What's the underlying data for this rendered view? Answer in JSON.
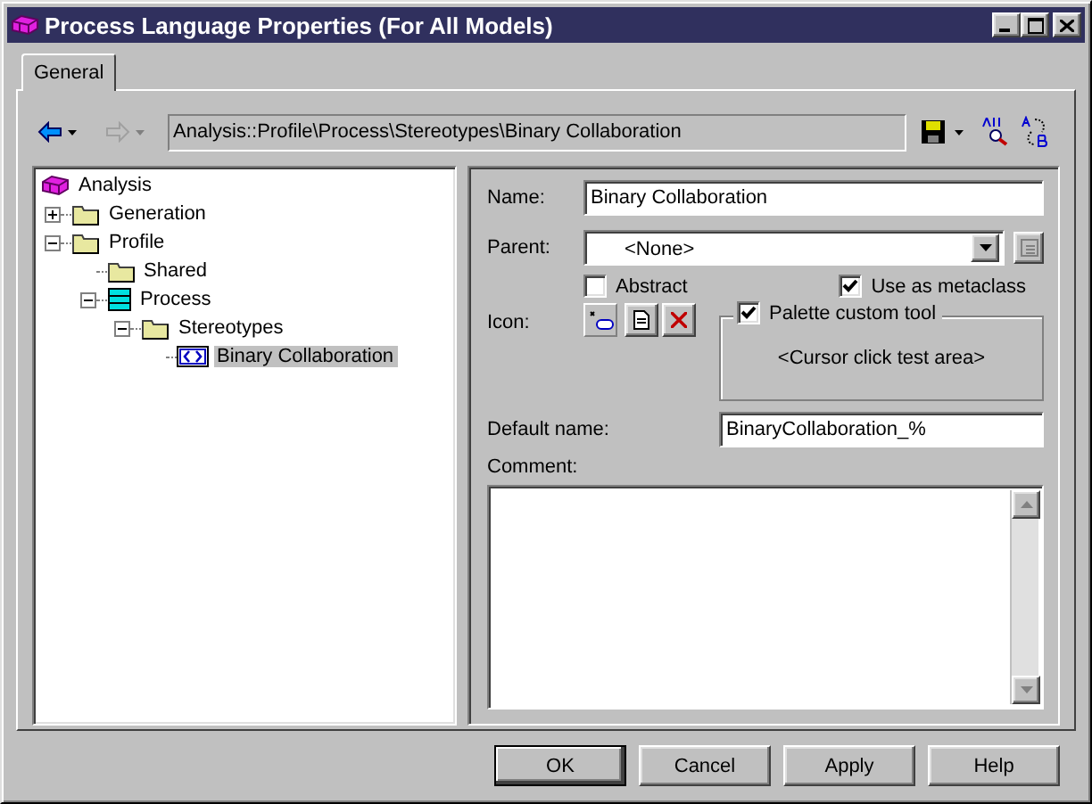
{
  "window": {
    "title": "Process Language Properties (For All Models)"
  },
  "tabs": [
    {
      "label": "General",
      "selected": true
    }
  ],
  "toolbar": {
    "nav_buttons": [
      {
        "kind": "back",
        "disabled": false
      },
      {
        "kind": "forward",
        "disabled": true
      }
    ],
    "path": "Analysis::Profile\\Process\\Stereotypes\\Binary Collaboration"
  },
  "tree": [
    {
      "label": "Analysis",
      "kind": "model",
      "selected": false,
      "children": [
        {
          "label": "Generation",
          "kind": "folder",
          "selected": false,
          "expanded": false
        },
        {
          "label": "Profile",
          "kind": "folder",
          "selected": false,
          "expanded": true,
          "children": [
            {
              "label": "Shared",
              "kind": "folder",
              "selected": false
            },
            {
              "label": "Process",
              "kind": "package",
              "selected": false,
              "expanded": true,
              "children": [
                {
                  "label": "Stereotypes",
                  "kind": "folder",
                  "selected": false,
                  "expanded": true,
                  "children": [
                    {
                      "label": "Binary Collaboration",
                      "kind": "stereotype",
                      "selected": true
                    }
                  ]
                }
              ]
            }
          ]
        }
      ]
    }
  ],
  "form": {
    "name_label": "Name:",
    "name": "Binary Collaboration",
    "parent_label": "Parent:",
    "parent": "<None>",
    "abstract": {
      "label": "Abstract",
      "checked": false
    },
    "metaclass": {
      "label": "Use as metaclass",
      "checked": true
    },
    "icon_label": "Icon:",
    "palette_tool": {
      "label": "Palette custom tool",
      "checked": true,
      "test_area": "<Cursor click test area>"
    },
    "default_name_label": "Default name:",
    "default_name": "BinaryCollaboration_%",
    "comment_label": "Comment:"
  },
  "buttons": [
    {
      "label": "OK",
      "default": true
    },
    {
      "label": "Cancel",
      "default": false
    },
    {
      "label": "Apply",
      "default": false
    },
    {
      "label": "Help",
      "default": false
    }
  ]
}
